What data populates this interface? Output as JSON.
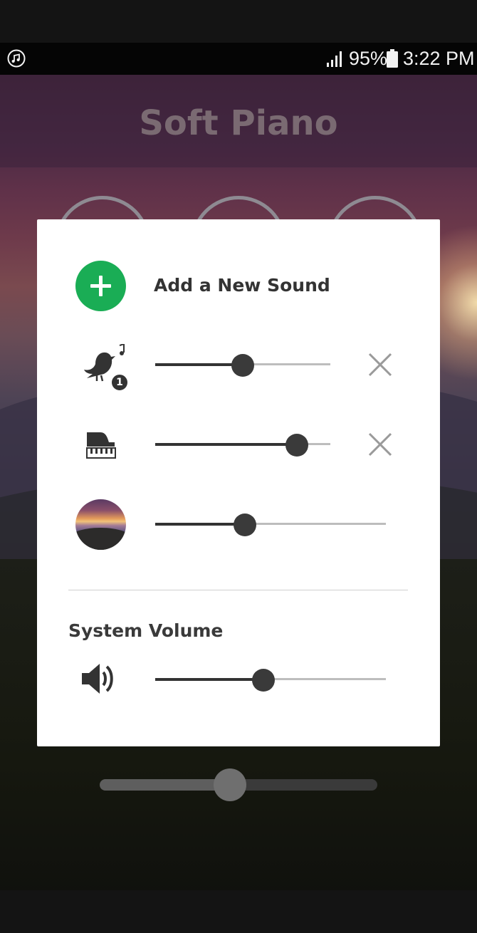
{
  "status_bar": {
    "battery_percent": "95%",
    "time": "3:22 PM",
    "icons": [
      "music-notification-icon",
      "signal-icon",
      "battery-icon"
    ]
  },
  "app": {
    "title": "Soft Piano"
  },
  "dialog": {
    "add_sound_label": "Add a New Sound",
    "sounds": [
      {
        "name": "bird-song-icon",
        "badge": "1",
        "volume": 0.5,
        "removable": true
      },
      {
        "name": "grand-piano-icon",
        "volume": 0.81,
        "removable": true
      },
      {
        "name": "scene-thumbnail",
        "volume": 0.39,
        "removable": false
      }
    ],
    "system_volume_label": "System Volume",
    "system_volume": 0.47
  },
  "background_slider": {
    "value": 0.47
  },
  "colors": {
    "accent_green": "#1aad55",
    "slider_dark": "#333333",
    "slider_light": "#bdbdbd"
  }
}
